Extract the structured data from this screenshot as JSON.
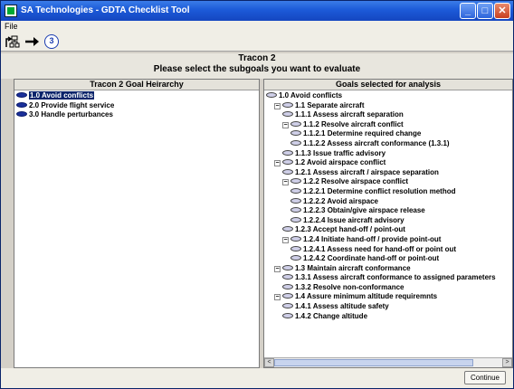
{
  "window": {
    "title": "SA Technologies - GDTA Checklist Tool",
    "minimize": "_",
    "maximize": "□",
    "close": "✕"
  },
  "menu": {
    "file": "File"
  },
  "toolbar": {
    "icon1": "org-chart-icon",
    "icon2": "arrow-icon",
    "icon3": "number-badge-icon",
    "badge_text": "3"
  },
  "header": {
    "title": "Tracon 2",
    "subtitle": "Please select the subgoals you want to evaluate"
  },
  "left_panel": {
    "heading": "Tracon 2 Goal Heirarchy",
    "items": [
      {
        "label": "1.0 Avoid conflicts",
        "selected": true
      },
      {
        "label": "2.0 Provide flight service",
        "selected": false
      },
      {
        "label": "3.0 Handle perturbances",
        "selected": false
      }
    ]
  },
  "right_panel": {
    "heading": "Goals selected for analysis",
    "items": [
      {
        "label": "1.0 Avoid conflicts",
        "level": 0,
        "expander": ""
      },
      {
        "label": "1.1 Separate aircraft",
        "level": 1,
        "expander": "−"
      },
      {
        "label": "1.1.1 Assess aircraft separation",
        "level": 2,
        "expander": ""
      },
      {
        "label": "1.1.2 Resolve aircraft conflict",
        "level": 2,
        "expander": "−"
      },
      {
        "label": "1.1.2.1 Determine required change",
        "level": 3,
        "expander": ""
      },
      {
        "label": "1.1.2.2 Assess aircraft conformance (1.3.1)",
        "level": 3,
        "expander": ""
      },
      {
        "label": "1.1.3 Issue traffic advisory",
        "level": 2,
        "expander": ""
      },
      {
        "label": "1.2 Avoid airspace conflict",
        "level": 1,
        "expander": "−"
      },
      {
        "label": "1.2.1 Assess aircraft / airspace separation",
        "level": 2,
        "expander": ""
      },
      {
        "label": "1.2.2 Resolve airspace conflict",
        "level": 2,
        "expander": "−"
      },
      {
        "label": "1.2.2.1 Determine conflict resolution method",
        "level": 3,
        "expander": ""
      },
      {
        "label": "1.2.2.2 Avoid airspace",
        "level": 3,
        "expander": ""
      },
      {
        "label": "1.2.2.3 Obtain/give airspace release",
        "level": 3,
        "expander": ""
      },
      {
        "label": "1.2.2.4 Issue aircraft advisory",
        "level": 3,
        "expander": ""
      },
      {
        "label": "1.2.3 Accept hand-off / point-out",
        "level": 2,
        "expander": ""
      },
      {
        "label": "1.2.4 Initiate hand-off / provide point-out",
        "level": 2,
        "expander": "−"
      },
      {
        "label": "1.2.4.1 Assess need for hand-off or point out",
        "level": 3,
        "expander": ""
      },
      {
        "label": "1.2.4.2 Coordinate hand-off or point-out",
        "level": 3,
        "expander": ""
      },
      {
        "label": "1.3 Maintain aircraft conformance",
        "level": 1,
        "expander": "−"
      },
      {
        "label": "1.3.1 Assess aircraft conformance to assigned parameters",
        "level": 2,
        "expander": ""
      },
      {
        "label": "1.3.2 Resolve non-conformance",
        "level": 2,
        "expander": ""
      },
      {
        "label": "1.4 Assure minimum altitude requiremnts",
        "level": 1,
        "expander": "−"
      },
      {
        "label": "1.4.1 Assess altitude safety",
        "level": 2,
        "expander": ""
      },
      {
        "label": "1.4.2 Change altitude",
        "level": 2,
        "expander": ""
      }
    ],
    "scroll_left": "<",
    "scroll_right": ">"
  },
  "footer": {
    "continue_label": "Continue"
  }
}
